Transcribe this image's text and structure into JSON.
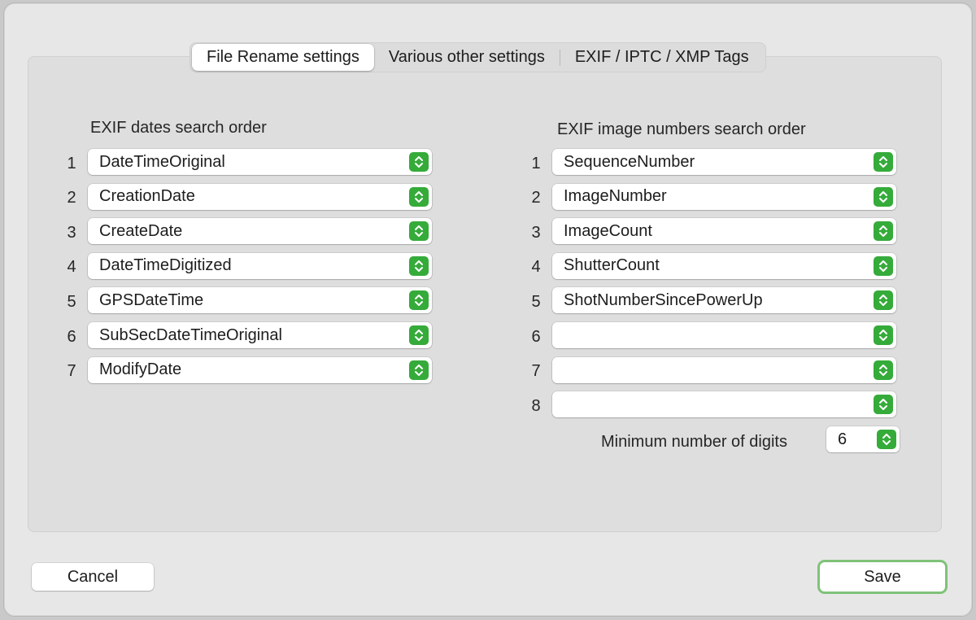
{
  "tabs": [
    {
      "label": "File Rename settings",
      "selected": true
    },
    {
      "label": "Various other settings",
      "selected": false
    },
    {
      "label": "EXIF / IPTC / XMP Tags",
      "selected": false
    }
  ],
  "dates": {
    "heading": "EXIF dates search order",
    "rows": [
      {
        "num": "1",
        "value": "DateTimeOriginal"
      },
      {
        "num": "2",
        "value": "CreationDate"
      },
      {
        "num": "3",
        "value": "CreateDate"
      },
      {
        "num": "4",
        "value": "DateTimeDigitized"
      },
      {
        "num": "5",
        "value": "GPSDateTime"
      },
      {
        "num": "6",
        "value": "SubSecDateTimeOriginal"
      },
      {
        "num": "7",
        "value": "ModifyDate"
      }
    ]
  },
  "numbers": {
    "heading": "EXIF image numbers search order",
    "rows": [
      {
        "num": "1",
        "value": "SequenceNumber"
      },
      {
        "num": "2",
        "value": "ImageNumber"
      },
      {
        "num": "3",
        "value": "ImageCount"
      },
      {
        "num": "4",
        "value": "ShutterCount"
      },
      {
        "num": "5",
        "value": "ShotNumberSincePowerUp"
      },
      {
        "num": "6",
        "value": ""
      },
      {
        "num": "7",
        "value": ""
      },
      {
        "num": "8",
        "value": ""
      }
    ],
    "min_digits_label": "Minimum number of digits",
    "min_digits_value": "6"
  },
  "buttons": {
    "cancel": "Cancel",
    "save": "Save"
  },
  "colors": {
    "accent": "#35ab3a",
    "default_button_ring": "#7fc279"
  },
  "icons": {
    "popup_stepper": "chevron-up-down-icon"
  }
}
